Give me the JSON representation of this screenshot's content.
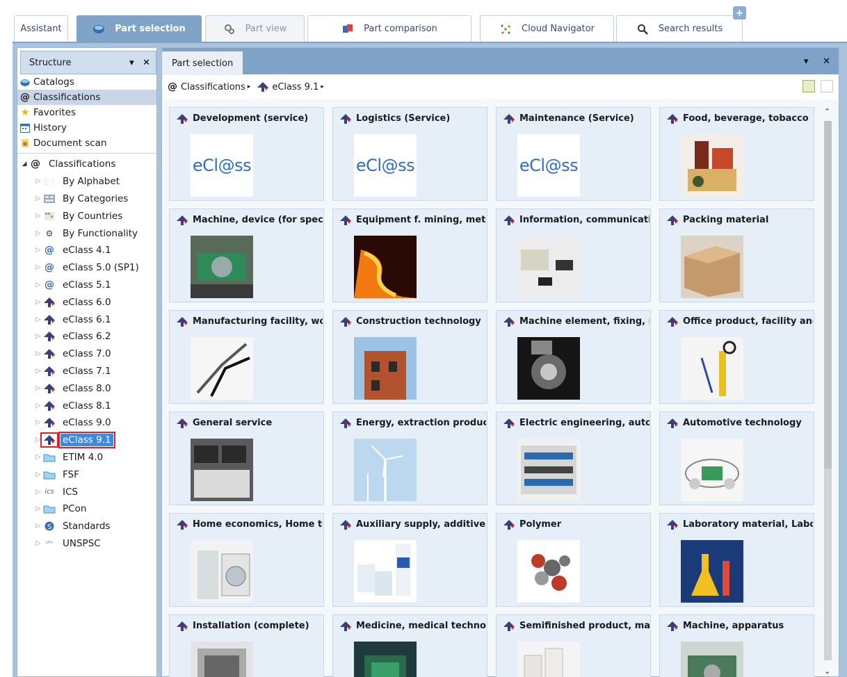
{
  "top_tabs": [
    {
      "label": "Assistant",
      "icon": "none",
      "state": "normal"
    },
    {
      "label": "Part selection",
      "icon": "catalog-icon",
      "state": "active"
    },
    {
      "label": "Part view",
      "icon": "part-view-icon",
      "state": "disabled"
    },
    {
      "label": "Part comparison",
      "icon": "comparison-icon",
      "state": "normal"
    },
    {
      "label": "Cloud Navigator",
      "icon": "cloud-navigator-icon",
      "state": "normal"
    },
    {
      "label": "Search results",
      "icon": "search-icon",
      "state": "normal"
    }
  ],
  "tab_add_label": "+",
  "structure": {
    "title": "Structure",
    "nav": [
      {
        "label": "Catalogs",
        "icon": "catalogs-icon",
        "selected": false
      },
      {
        "label": "Classifications",
        "icon": "at-sign-icon",
        "selected": true
      },
      {
        "label": "Favorites",
        "icon": "star-icon",
        "selected": false
      },
      {
        "label": "History",
        "icon": "history-icon",
        "selected": false
      },
      {
        "label": "Document scan",
        "icon": "document-scan-icon",
        "selected": false
      }
    ],
    "tree_root": {
      "label": "Classifications",
      "icon": "at-sign-icon",
      "arrow": "◢"
    },
    "tree": [
      {
        "label": "By Alphabet",
        "icon": "alphabet-icon"
      },
      {
        "label": "By Categories",
        "icon": "categories-icon"
      },
      {
        "label": "By Countries",
        "icon": "countries-icon"
      },
      {
        "label": "By Functionality",
        "icon": "functionality-icon"
      },
      {
        "label": "eClass 4.1",
        "icon": "eclass-at-icon"
      },
      {
        "label": "eClass 5.0 (SP1)",
        "icon": "eclass-at-icon"
      },
      {
        "label": "eClass 5.1",
        "icon": "eclass-at-icon"
      },
      {
        "label": "eClass 6.0",
        "icon": "eclass-arrow-icon"
      },
      {
        "label": "eClass 6.1",
        "icon": "eclass-arrow-icon"
      },
      {
        "label": "eClass 6.2",
        "icon": "eclass-arrow-icon"
      },
      {
        "label": "eClass 7.0",
        "icon": "eclass-arrow-icon"
      },
      {
        "label": "eClass 7.1",
        "icon": "eclass-arrow-icon"
      },
      {
        "label": "eClass 8.0",
        "icon": "eclass-arrow-icon"
      },
      {
        "label": "eClass 8.1",
        "icon": "eclass-arrow-icon"
      },
      {
        "label": "eClass 9.0",
        "icon": "eclass-arrow-icon"
      },
      {
        "label": "eClass 9.1",
        "icon": "eclass-arrow-icon",
        "selected": true
      },
      {
        "label": "ETIM 4.0",
        "icon": "folder-icon"
      },
      {
        "label": "FSF",
        "icon": "folder-icon"
      },
      {
        "label": "ICS",
        "icon": "ics-icon"
      },
      {
        "label": "PCon",
        "icon": "folder-icon"
      },
      {
        "label": "Standards",
        "icon": "standards-icon"
      },
      {
        "label": "UNSPSC",
        "icon": "unspsc-icon"
      }
    ]
  },
  "content": {
    "title": "Part selection",
    "breadcrumb": [
      {
        "label": "Classifications",
        "icon": "at-sign-icon"
      },
      {
        "label": "eClass 9.1",
        "icon": "eclass-arrow-icon"
      }
    ],
    "breadcrumb_sep": "▸",
    "cards": [
      {
        "title": "Development (service)",
        "thumb": "eclass-logo",
        "logo_text": "eCl@ss"
      },
      {
        "title": "Logistics (Service)",
        "thumb": "eclass-logo",
        "logo_text": "eCl@ss"
      },
      {
        "title": "Maintenance (Service)",
        "thumb": "eclass-logo",
        "logo_text": "eCl@ss"
      },
      {
        "title": "Food, beverage, tobacco",
        "thumb": "food-image"
      },
      {
        "title": "Machine, device (for specia",
        "thumb": "machine-image"
      },
      {
        "title": "Equipment f. mining, metal",
        "thumb": "molten-metal-image"
      },
      {
        "title": "Information, communicatio",
        "thumb": "office-devices-image"
      },
      {
        "title": "Packing material",
        "thumb": "cardboard-box-image"
      },
      {
        "title": "Manufacturing facility, wor",
        "thumb": "pliers-image"
      },
      {
        "title": "Construction technology",
        "thumb": "brick-house-image"
      },
      {
        "title": "Machine element, fixing, m",
        "thumb": "engine-image"
      },
      {
        "title": "Office product, facility and",
        "thumb": "office-supplies-image"
      },
      {
        "title": "General service",
        "thumb": "keyboard-image"
      },
      {
        "title": "Energy, extraction product,",
        "thumb": "wind-turbines-image"
      },
      {
        "title": "Electric engineering, autom",
        "thumb": "electric-cabinet-image"
      },
      {
        "title": "Automotive technology",
        "thumb": "car-image"
      },
      {
        "title": "Home economics, Home te",
        "thumb": "washing-machine-image"
      },
      {
        "title": "Auxiliary supply, additive, c",
        "thumb": "containers-image"
      },
      {
        "title": "Polymer",
        "thumb": "molecule-image"
      },
      {
        "title": "Laboratory material, Labora",
        "thumb": "lab-flasks-image"
      },
      {
        "title": "Installation (complete)",
        "thumb": "installation-image"
      },
      {
        "title": "Medicine, medical technolo",
        "thumb": "medical-device-image"
      },
      {
        "title": "Semifinished product, mat",
        "thumb": "pipes-image"
      },
      {
        "title": "Machine, apparatus",
        "thumb": "apparatus-image"
      }
    ]
  },
  "colors": {
    "accent": "#7fa3c6",
    "selection": "#3b8ce0",
    "highlight_outline": "#e02020",
    "eclass_logo": "#2d6fc4"
  }
}
